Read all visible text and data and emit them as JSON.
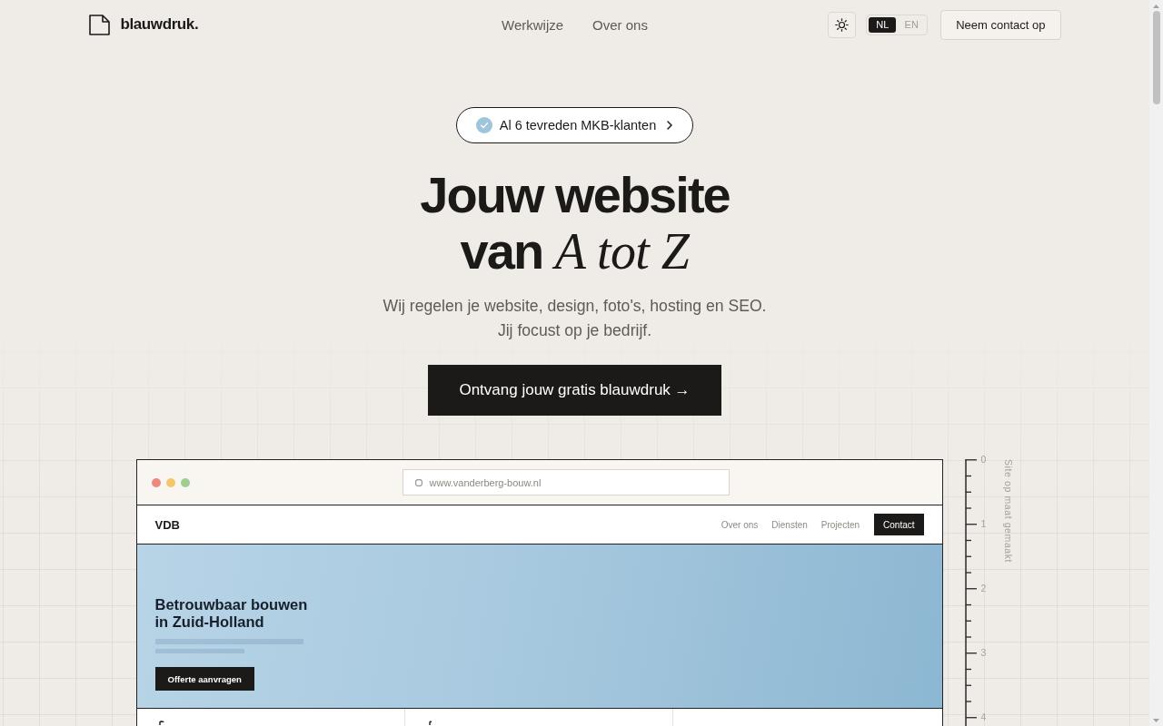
{
  "header": {
    "logo": "blauwdruk.",
    "nav": [
      "Werkwijze",
      "Over ons"
    ],
    "languages": [
      {
        "label": "NL",
        "selected": true
      },
      {
        "label": "EN",
        "selected": false
      }
    ],
    "contact_button": "Neem contact op"
  },
  "hero": {
    "badge": "Al 6 tevreden MKB-klanten",
    "headline": [
      "Jouw website",
      "van *A tot Z*"
    ],
    "subtitle": [
      "Wij regelen je website, design, foto's, hosting en SEO.",
      "Jij focust op je bedrijf."
    ],
    "cta": "Ontvang jouw gratis blauwdruk →"
  },
  "preview": {
    "url": "www.vanderberg-bouw.nl",
    "site": {
      "logo": "VDB",
      "nav": [
        "Over ons",
        "Diensten",
        "Projecten"
      ],
      "nav_button": "Contact",
      "hero_title": [
        "Betrouwbaar bouwen",
        "in Zuid-Holland"
      ],
      "hero_button": "Offerte aanvragen"
    }
  },
  "ruler": {
    "ticks": [
      "0",
      "1",
      "2",
      "3",
      "4"
    ],
    "label": "Site op maat gemaakt"
  }
}
